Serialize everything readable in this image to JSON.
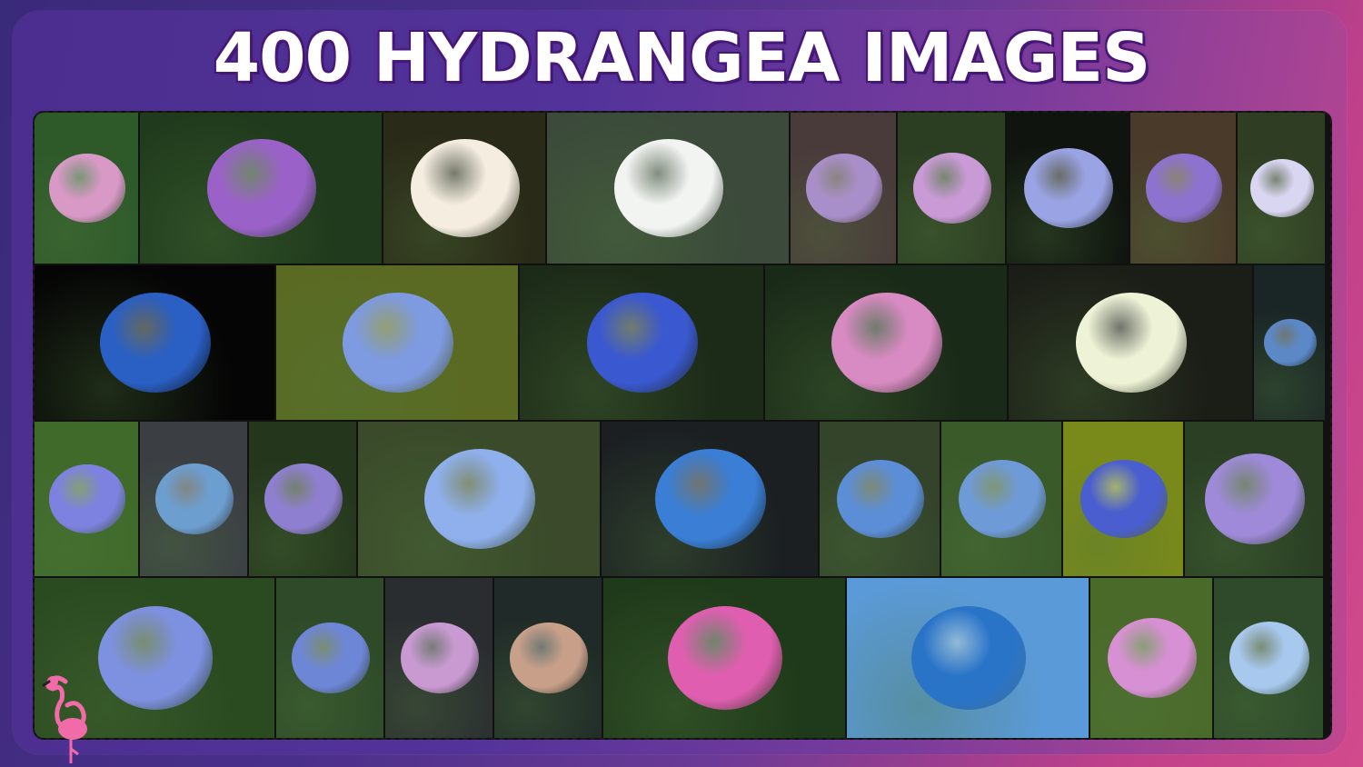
{
  "title": "400 HYDRANGEA IMAGES",
  "tiles": [
    {
      "bg": "#2e5a2a",
      "bloom": "#d899c6",
      "r": 0
    },
    {
      "bg": "#1f3a1c",
      "bloom": "#9a62c8",
      "r": 0
    },
    {
      "bg": "#2a2a18",
      "bloom": "#f4ede0",
      "r": 0
    },
    {
      "bg": "#3b4a3a",
      "bloom": "#f2f4f2",
      "r": 0
    },
    {
      "bg": "#4a3b3b",
      "bloom": "#a98fc9",
      "r": 0
    },
    {
      "bg": "#2c3e22",
      "bloom": "#c99ad6",
      "r": 0
    },
    {
      "bg": "#0f140f",
      "bloom": "#9aa3e4",
      "r": 0
    },
    {
      "bg": "#4a3a2a",
      "bloom": "#8e72d0",
      "r": 0
    },
    {
      "bg": "#2f3d23",
      "bloom": "#d9d6f2",
      "r": 0
    },
    {
      "bg": "#050505",
      "bloom": "#2a5fc4",
      "r": 1
    },
    {
      "bg": "#5a6a22",
      "bloom": "#7e9ae0",
      "r": 1
    },
    {
      "bg": "#1c2a18",
      "bloom": "#3a58d0",
      "r": 1
    },
    {
      "bg": "#1a2a18",
      "bloom": "#d88ac2",
      "r": 1
    },
    {
      "bg": "#1b1d17",
      "bloom": "#eef2d6",
      "r": 1
    },
    {
      "bg": "#1a2626",
      "bloom": "#5c88c8",
      "r": 1
    },
    {
      "bg": "#3f6a2a",
      "bloom": "#7d82e0",
      "r": 2
    },
    {
      "bg": "#3b3f44",
      "bloom": "#6d9ed0",
      "r": 2
    },
    {
      "bg": "#24361c",
      "bloom": "#8f7fd0",
      "r": 2
    },
    {
      "bg": "#3a4a2a",
      "bloom": "#8fb0ec",
      "r": 2
    },
    {
      "bg": "#1b1f22",
      "bloom": "#3a7ed6",
      "r": 2
    },
    {
      "bg": "#33442a",
      "bloom": "#5c8ed8",
      "r": 2
    },
    {
      "bg": "#3a5a2a",
      "bloom": "#6f9ad8",
      "r": 2
    },
    {
      "bg": "#7a8a1a",
      "bloom": "#4a5ed0",
      "r": 2
    },
    {
      "bg": "#2a3f24",
      "bloom": "#9e8ad8",
      "r": 2
    },
    {
      "bg": "#2a4a20",
      "bloom": "#7e90e0",
      "r": 3
    },
    {
      "bg": "#2e4a28",
      "bloom": "#6e86d6",
      "r": 3
    },
    {
      "bg": "#2a2d30",
      "bloom": "#c99ad2",
      "r": 3
    },
    {
      "bg": "#202a28",
      "bloom": "#c8a08a",
      "r": 3
    },
    {
      "bg": "#1f3a1a",
      "bloom": "#e05eb0",
      "r": 3
    },
    {
      "bg": "#5a9ad8",
      "bloom": "#2a74c8",
      "r": 3
    },
    {
      "bg": "#4a6a2a",
      "bloom": "#d890d4",
      "r": 3
    },
    {
      "bg": "#2e4a2a",
      "bloom": "#a8c8ee",
      "r": 3
    }
  ]
}
